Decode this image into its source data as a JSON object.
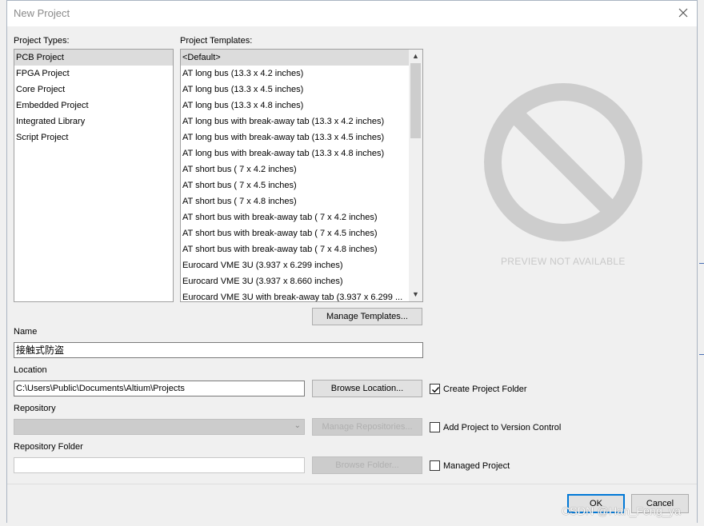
{
  "window": {
    "title": "New Project"
  },
  "project_types": {
    "label": "Project Types:",
    "items": [
      "PCB Project",
      "FPGA Project",
      "Core Project",
      "Embedded Project",
      "Integrated Library",
      "Script Project"
    ],
    "selected_index": 0
  },
  "project_templates": {
    "label": "Project Templates:",
    "items": [
      "<Default>",
      "AT long bus (13.3 x 4.2 inches)",
      "AT long bus (13.3 x 4.5 inches)",
      "AT long bus (13.3 x 4.8 inches)",
      "AT long bus with break-away tab (13.3 x 4.2 inches)",
      "AT long bus with break-away tab (13.3 x 4.5 inches)",
      "AT long bus with break-away tab (13.3 x 4.8 inches)",
      "AT short bus ( 7 x 4.2 inches)",
      "AT short bus ( 7 x 4.5 inches)",
      "AT short bus ( 7 x 4.8 inches)",
      "AT short bus with break-away tab ( 7 x 4.2 inches)",
      "AT short bus with break-away tab ( 7 x 4.5 inches)",
      "AT short bus with break-away tab ( 7 x 4.8 inches)",
      "Eurocard VME 3U (3.937 x 6.299 inches)",
      "Eurocard VME 3U (3.937 x 8.660 inches)",
      "Eurocard VME 3U with break-away tab (3.937 x 6.299 ..."
    ],
    "selected_index": 0
  },
  "preview": {
    "text": "PREVIEW NOT AVAILABLE"
  },
  "buttons": {
    "manage_templates": "Manage Templates...",
    "browse_location": "Browse Location...",
    "manage_repositories": "Manage Repositories...",
    "browse_folder": "Browse Folder...",
    "ok": "OK",
    "cancel": "Cancel"
  },
  "fields": {
    "name_label": "Name",
    "name_value": "接触式防盗",
    "location_label": "Location",
    "location_value": "C:\\Users\\Public\\Documents\\Altium\\Projects",
    "repository_label": "Repository",
    "repository_value": "",
    "repository_folder_label": "Repository Folder",
    "repository_folder_value": ""
  },
  "checkboxes": {
    "create_project_folder": {
      "label": "Create Project Folder",
      "checked": true
    },
    "add_to_version_control": {
      "label": "Add Project to Version Control",
      "checked": false
    },
    "managed_project": {
      "label": "Managed Project",
      "checked": false
    }
  },
  "watermark": "CSDN @Han_Feng_ya",
  "colors": {
    "accent": "#0078d7",
    "selection": "#dcdcdc",
    "disabled_text": "#b0b0b0"
  }
}
